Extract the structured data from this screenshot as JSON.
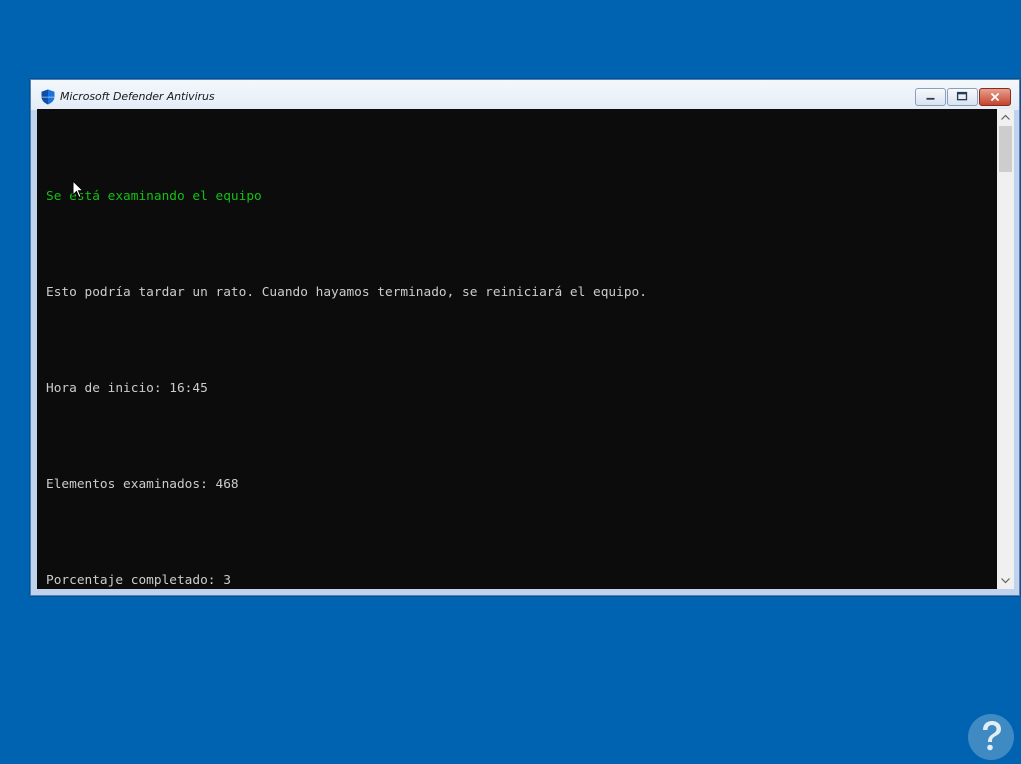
{
  "window": {
    "title": "Microsoft Defender Antivirus",
    "controls": {
      "minimize": "minimize-icon",
      "maximize": "maximize-icon",
      "close": "close-icon"
    }
  },
  "console": {
    "lines": [
      "Se está examinando el equipo",
      "Esto podría tardar un rato. Cuando hayamos terminado, se reiniciará el equipo.",
      "Hora de inicio: 16:45",
      "Elementos examinados: 468",
      "Porcentaje completado: 3"
    ],
    "colors": {
      "heading": "#13c013",
      "text": "#cccccc",
      "background": "#0c0c0c"
    }
  },
  "desktop": {
    "background": "#0063b1"
  }
}
